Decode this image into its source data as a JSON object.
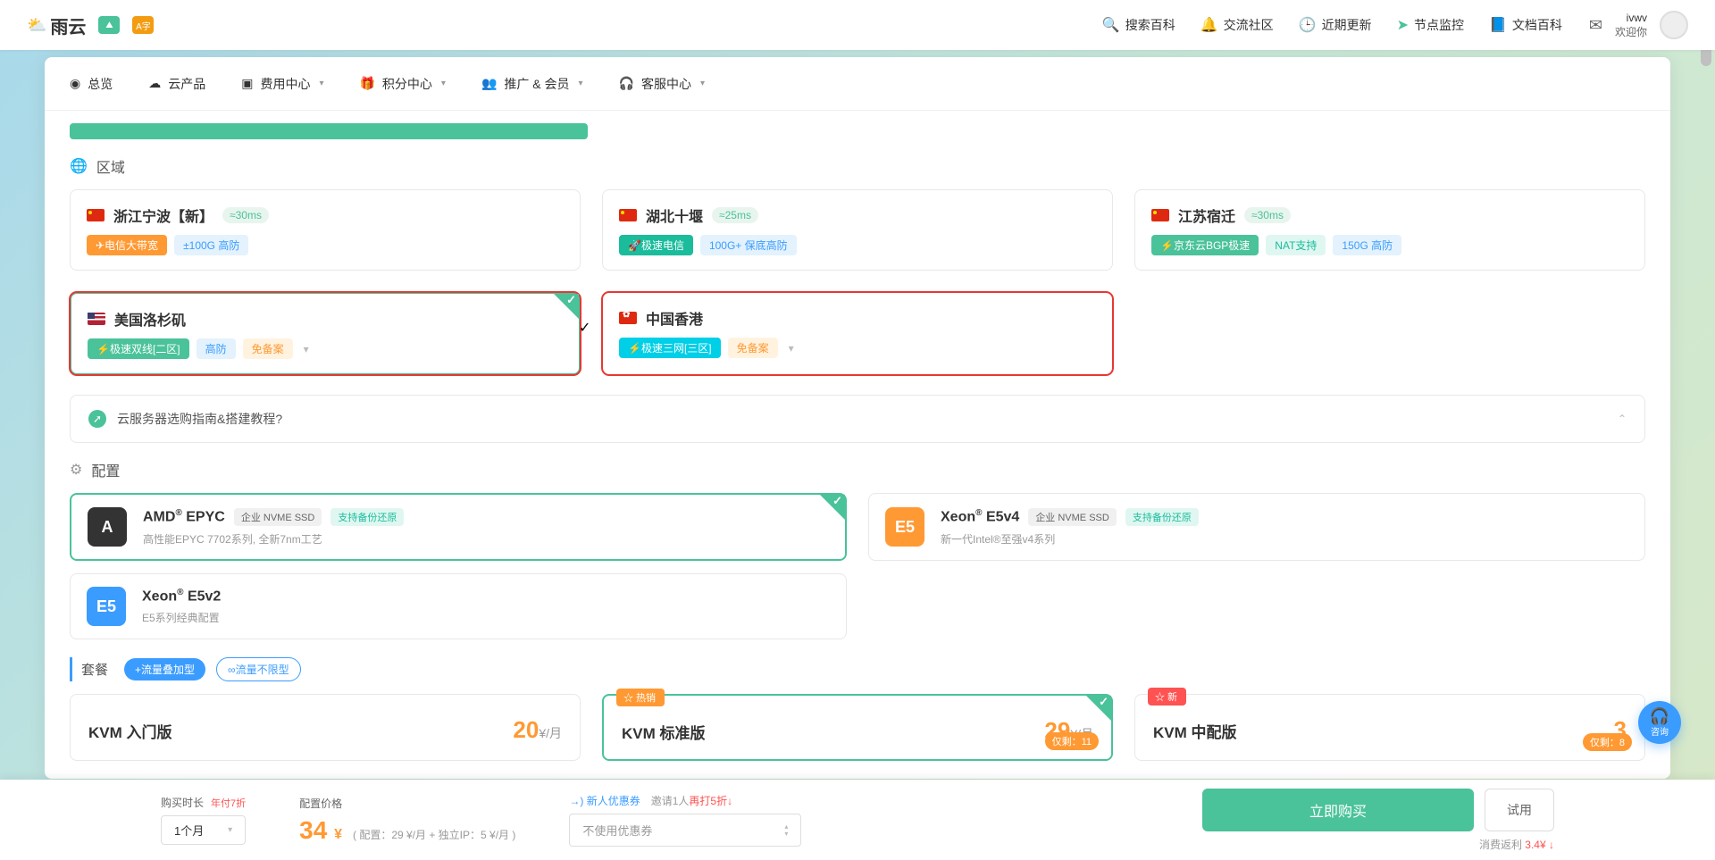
{
  "header": {
    "logo_text": "雨云",
    "nav": [
      {
        "icon": "search",
        "label": "搜索百科"
      },
      {
        "icon": "bell",
        "label": "交流社区"
      },
      {
        "icon": "clock",
        "label": "近期更新"
      },
      {
        "icon": "send",
        "label": "节点监控"
      },
      {
        "icon": "book",
        "label": "文档百科"
      }
    ],
    "user": {
      "name": "ivwv",
      "greeting": "欢迎你"
    }
  },
  "subnav": [
    {
      "icon": "◉",
      "label": "总览"
    },
    {
      "icon": "☁",
      "label": "云产品"
    },
    {
      "icon": "▣",
      "label": "费用中心",
      "caret": true
    },
    {
      "icon": "🎁",
      "label": "积分中心",
      "caret": true
    },
    {
      "icon": "👥",
      "label": "推广 & 会员",
      "caret": true
    },
    {
      "icon": "🎧",
      "label": "客服中心",
      "caret": true
    }
  ],
  "sections": {
    "region": "区域",
    "config": "配置",
    "package": "套餐"
  },
  "regions": [
    {
      "flag": "cn",
      "name": "浙江宁波【新】",
      "latency": "≈30ms",
      "tags": [
        {
          "cls": "orange",
          "text": "✈电信大带宽"
        },
        {
          "cls": "lightblue",
          "text": "±100G 高防"
        }
      ]
    },
    {
      "flag": "cn",
      "name": "湖北十堰",
      "latency": "≈25ms",
      "tags": [
        {
          "cls": "teal",
          "text": "🚀极速电信"
        },
        {
          "cls": "lightblue",
          "text": "100G+ 保底高防"
        }
      ]
    },
    {
      "flag": "cn",
      "name": "江苏宿迁",
      "latency": "≈30ms",
      "tags": [
        {
          "cls": "green",
          "text": "⚡京东云BGP极速"
        },
        {
          "cls": "lightteal",
          "text": "NAT支持"
        },
        {
          "cls": "lightblue",
          "text": "150G 高防"
        }
      ]
    },
    {
      "flag": "us",
      "name": "美国洛杉矶",
      "latency": "",
      "highlight": true,
      "selected": true,
      "tags": [
        {
          "cls": "green",
          "text": "⚡极速双线[二区]"
        },
        {
          "cls": "lightblue",
          "text": "高防"
        },
        {
          "cls": "lightorange",
          "text": "免备案"
        }
      ],
      "caret": true
    },
    {
      "flag": "hk",
      "name": "中国香港",
      "latency": "",
      "highlight": true,
      "tags": [
        {
          "cls": "cyan",
          "text": "⚡极速三网[三区]"
        },
        {
          "cls": "lightorange",
          "text": "免备案"
        }
      ],
      "caret": true
    }
  ],
  "guide": {
    "text": "云服务器选购指南&搭建教程?"
  },
  "configs": [
    {
      "badge": "A",
      "badge_cls": "dark",
      "title_pre": "AMD",
      "title_sup": "®",
      "title_post": " EPYC",
      "tags": [
        {
          "cls": "gray",
          "text": "企业 NVME SSD"
        },
        {
          "cls": "green-light",
          "text": "支持备份还原"
        }
      ],
      "desc": "高性能EPYC 7702系列, 全新7nm工艺",
      "selected": true
    },
    {
      "badge": "E5",
      "badge_cls": "orange",
      "title_pre": "Xeon",
      "title_sup": "®",
      "title_post": " E5v4",
      "tags": [
        {
          "cls": "gray",
          "text": "企业 NVME SSD"
        },
        {
          "cls": "green-light",
          "text": "支持备份还原"
        }
      ],
      "desc": "新一代Intel®至强v4系列"
    },
    {
      "badge": "E5",
      "badge_cls": "blue",
      "title_pre": "Xeon",
      "title_sup": "®",
      "title_post": " E5v2",
      "tags": [],
      "desc": "E5系列经典配置"
    }
  ],
  "pkg_tabs": [
    {
      "label": "+流量叠加型",
      "active": true
    },
    {
      "label": "∞流量不限型",
      "active": false
    }
  ],
  "packages": [
    {
      "name": "KVM 入门版",
      "price": "20",
      "unit": "¥/月"
    },
    {
      "corner": "☆ 热销",
      "corner_cls": "hot",
      "name": "KVM 标准版",
      "price": "29",
      "unit": "¥/月",
      "remain": "仅剩：11",
      "selected": true
    },
    {
      "corner": "☆ 新",
      "corner_cls": "new",
      "name": "KVM 中配版",
      "price": "3",
      "unit": "",
      "remain": "仅剩：8"
    }
  ],
  "bottom": {
    "duration_label": "购买时长",
    "duration_promo": "年付7折",
    "duration_value": "1个月",
    "price_label": "配置价格",
    "price": "34",
    "currency": "¥",
    "price_detail": "( 配置：29 ¥/月 + 独立IP：5 ¥/月 )",
    "coupon_link": "→) 新人优惠券",
    "coupon_promo_pre": "邀请1人",
    "coupon_promo_red": "再打5折",
    "coupon_select": "不使用优惠券",
    "buy_btn": "立即购买",
    "trial_btn": "试用",
    "rebate_label": "消费返利",
    "rebate_amt": "3.4¥",
    "rebate_arrow": "↓"
  },
  "help": {
    "label": "咨询"
  }
}
